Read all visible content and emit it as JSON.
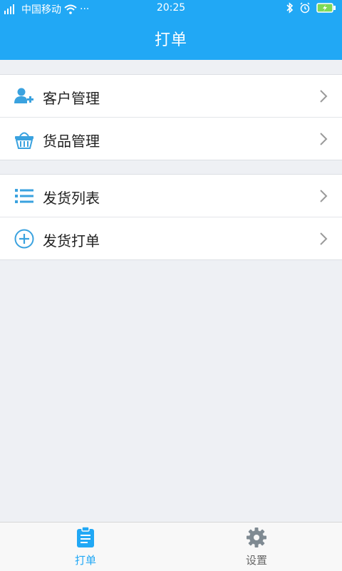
{
  "status_bar": {
    "carrier": "中国移动",
    "more": "···",
    "time": "20:25",
    "icons": [
      "signal-icon",
      "wifi-icon",
      "bluetooth-icon",
      "alarm-icon",
      "battery-charging-icon"
    ]
  },
  "header": {
    "title": "打单",
    "color": "#21a8f5"
  },
  "menu": {
    "group1": [
      {
        "label": "客户管理",
        "icon": "add-user-icon"
      },
      {
        "label": "货品管理",
        "icon": "basket-icon"
      }
    ],
    "group2": [
      {
        "label": "发货列表",
        "icon": "list-icon"
      },
      {
        "label": "发货打单",
        "icon": "plus-circle-icon"
      }
    ]
  },
  "tabbar": {
    "tabs": [
      {
        "label": "打单",
        "icon": "clipboard-icon",
        "active": true
      },
      {
        "label": "设置",
        "icon": "gear-icon",
        "active": false
      }
    ],
    "active_color": "#21a8f5"
  }
}
